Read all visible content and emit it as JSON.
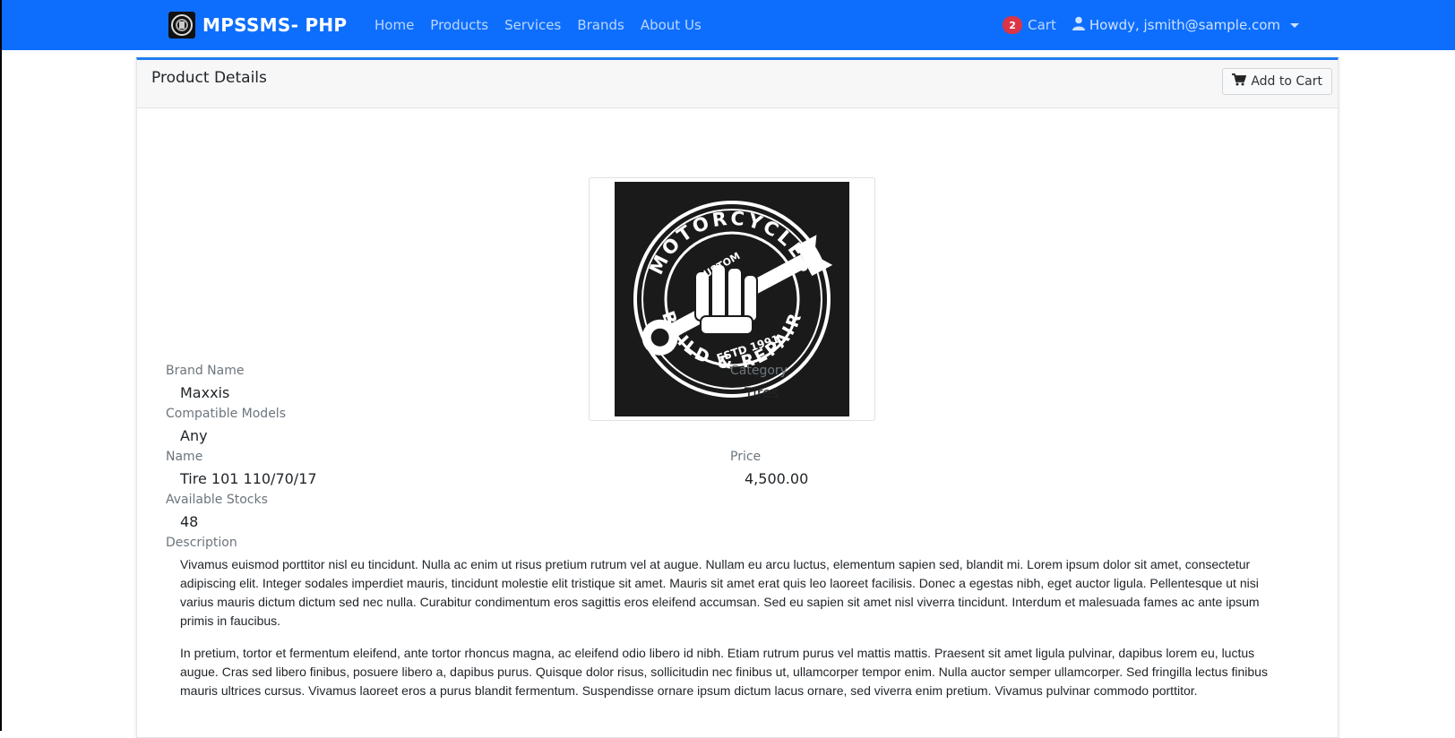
{
  "app": {
    "brand": "MPSSMS- PHP"
  },
  "nav": {
    "items": [
      "Home",
      "Products",
      "Services",
      "Brands",
      "About Us"
    ]
  },
  "header_right": {
    "cart_count": "2",
    "cart_label": "Cart",
    "user_label": "Howdy, jsmith@sample.com"
  },
  "card": {
    "title": "Product Details",
    "add_to_cart_label": "Add to Cart"
  },
  "product_image": {
    "arc_top": "MOTORCYCLES",
    "custom": "CUSTOM",
    "estd": "ESTD 1991",
    "arc_bottom": "BUILD & REPAIR"
  },
  "fields": {
    "brand_label": "Brand Name",
    "brand": "Maxxis",
    "category_label": "Category",
    "category": "Tires",
    "compatible_label": "Compatible Models",
    "compatible": "Any",
    "name_label": "Name",
    "name": "Tire 101 110/70/17",
    "price_label": "Price",
    "price": "4,500.00",
    "stocks_label": "Available Stocks",
    "stocks": "48",
    "description_label": "Description"
  },
  "description": [
    "Vivamus euismod porttitor nisl eu tincidunt. Nulla ac enim ut risus pretium rutrum vel at augue. Nullam eu arcu luctus, elementum sapien sed, blandit mi. Lorem ipsum dolor sit amet, consectetur adipiscing elit. Integer sodales imperdiet mauris, tincidunt molestie elit tristique sit amet. Mauris sit amet erat quis leo laoreet facilisis. Donec a egestas nibh, eget auctor ligula. Pellentesque ut nisi varius mauris dictum dictum sed nec nulla. Curabitur condimentum eros sagittis eros eleifend accumsan. Sed eu sapien sit amet nisl viverra tincidunt. Interdum et malesuada fames ac ante ipsum primis in faucibus.",
    "In pretium, tortor et fermentum eleifend, ante tortor rhoncus magna, ac eleifend odio libero id nibh. Etiam rutrum purus vel mattis mattis. Praesent sit amet ligula pulvinar, dapibus lorem eu, luctus augue. Cras sed libero finibus, posuere libero a, dapibus purus. Quisque dolor risus, sollicitudin nec finibus ut, ullamcorper tempor enim. Nulla auctor semper ullamcorper. Sed fringilla lectus finibus mauris ultrices cursus. Vivamus laoreet eros a purus blandit fermentum. Suspendisse ornare ipsum dictum lacus ornare, sed viverra enim pretium. Vivamus pulvinar commodo porttitor."
  ],
  "colors": {
    "navbar": "#0d6efd",
    "badge": "#dc3545",
    "card_accent": "#1e7cf2"
  },
  "icons": {
    "brand": "motorcycle-logo-icon",
    "cart_button": "cart-icon",
    "user": "user-icon",
    "dropdown": "caret-down-icon"
  }
}
